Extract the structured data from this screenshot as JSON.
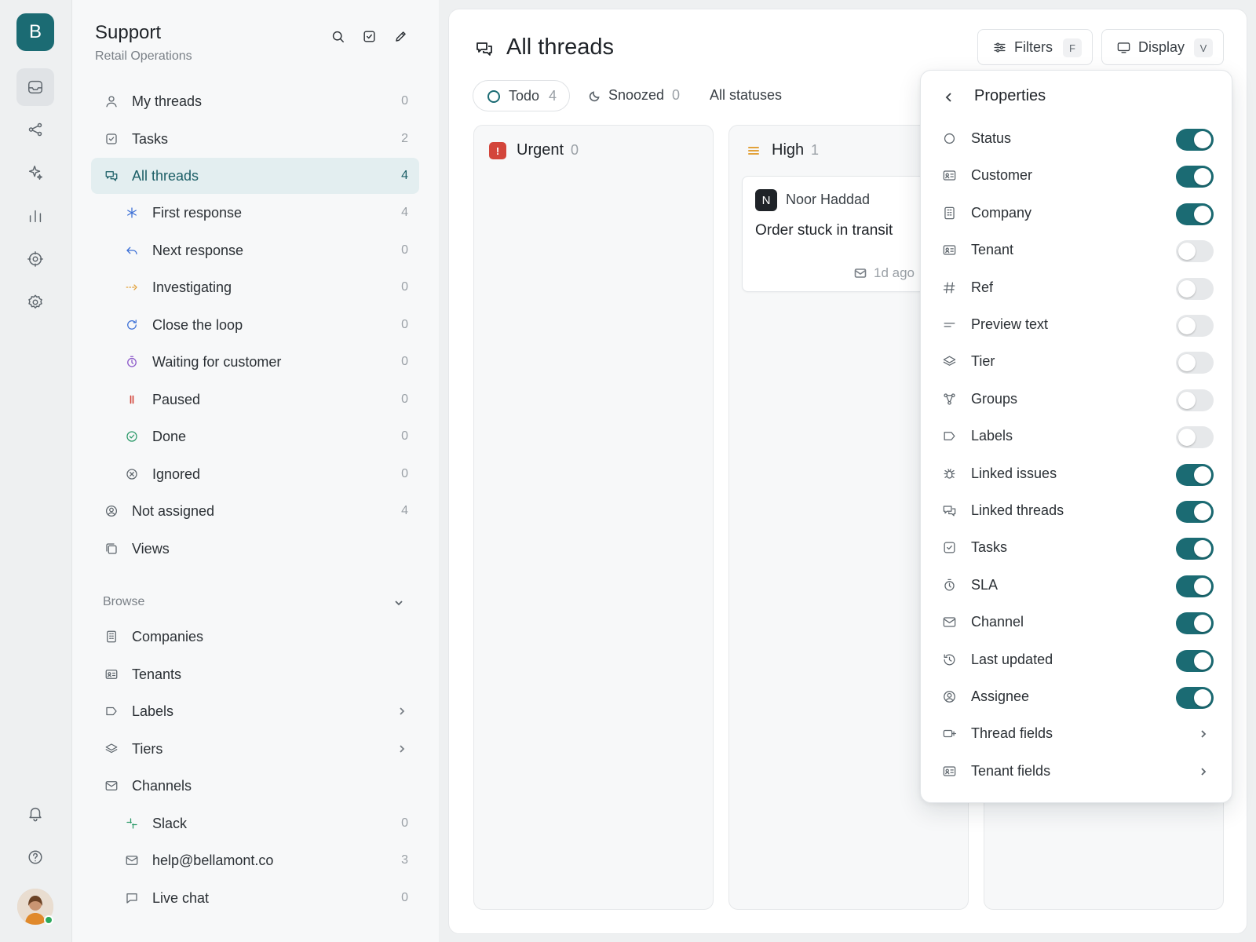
{
  "rail": {
    "workspace_letter": "B",
    "items": [
      "inbox-icon",
      "share-icon",
      "sparkle-icon",
      "chart-icon",
      "target-icon",
      "gear-icon"
    ],
    "bottom": [
      "bell-icon",
      "help-icon"
    ]
  },
  "sidebar": {
    "title": "Support",
    "subtitle": "Retail Operations",
    "nav": [
      {
        "label": "My threads",
        "count": "0",
        "icon": "user-icon"
      },
      {
        "label": "Tasks",
        "count": "2",
        "icon": "check-square-icon"
      },
      {
        "label": "All threads",
        "count": "4",
        "icon": "chat-icon",
        "active": true
      },
      {
        "label": "First response",
        "count": "4",
        "icon": "asterisk-icon",
        "color": "#3b6fd6"
      },
      {
        "label": "Next response",
        "count": "0",
        "icon": "reply-icon",
        "color": "#3b6fd6"
      },
      {
        "label": "Investigating",
        "count": "0",
        "icon": "dashed-arrow-icon",
        "color": "#e2a23b"
      },
      {
        "label": "Close the loop",
        "count": "0",
        "icon": "refresh-icon",
        "color": "#3b6fd6"
      },
      {
        "label": "Waiting for customer",
        "count": "0",
        "icon": "stopwatch-icon",
        "color": "#8a56c9"
      },
      {
        "label": "Paused",
        "count": "0",
        "icon": "pause-icon",
        "color": "#d3453b"
      },
      {
        "label": "Done",
        "count": "0",
        "icon": "check-circle-icon",
        "color": "#2c9a6a"
      },
      {
        "label": "Ignored",
        "count": "0",
        "icon": "x-circle-icon"
      },
      {
        "label": "Not assigned",
        "count": "4",
        "icon": "user-circle-icon"
      },
      {
        "label": "Views",
        "count": "",
        "icon": "views-icon"
      }
    ],
    "browse_label": "Browse",
    "browse": [
      {
        "label": "Companies",
        "icon": "building-icon"
      },
      {
        "label": "Tenants",
        "icon": "id-card-icon"
      },
      {
        "label": "Labels",
        "icon": "tag-icon",
        "chevron": true
      },
      {
        "label": "Tiers",
        "icon": "layers-icon",
        "chevron": true
      },
      {
        "label": "Channels",
        "icon": "mail-icon"
      },
      {
        "label": "Slack",
        "count": "0",
        "icon": "slack-icon",
        "sub": true
      },
      {
        "label": "help@bellamont.co",
        "count": "3",
        "icon": "mail-icon",
        "sub": true
      },
      {
        "label": "Live chat",
        "count": "0",
        "icon": "chat-bubble-icon",
        "sub": true
      }
    ]
  },
  "main": {
    "title": "All threads",
    "filters_label": "Filters",
    "filters_key": "F",
    "display_label": "Display",
    "display_key": "V",
    "tabs": {
      "todo_label": "Todo",
      "todo_count": "4",
      "snoozed_label": "Snoozed",
      "snoozed_count": "0",
      "all_label": "All statuses"
    },
    "columns": [
      {
        "name": "Urgent",
        "count": "0",
        "badge": "!"
      },
      {
        "name": "High",
        "count": "1"
      }
    ],
    "card": {
      "avatar": "N",
      "name": "Noor Haddad",
      "title": "Order stuck in transit",
      "time": "1d ago"
    }
  },
  "properties": {
    "title": "Properties",
    "items": [
      {
        "label": "Status",
        "on": true,
        "icon": "circle-icon"
      },
      {
        "label": "Customer",
        "on": true,
        "icon": "id-card-icon"
      },
      {
        "label": "Company",
        "on": true,
        "icon": "building-icon"
      },
      {
        "label": "Tenant",
        "on": false,
        "icon": "id-card-icon"
      },
      {
        "label": "Ref",
        "on": false,
        "icon": "hash-icon"
      },
      {
        "label": "Preview text",
        "on": false,
        "icon": "text-lines-icon"
      },
      {
        "label": "Tier",
        "on": false,
        "icon": "layers-icon"
      },
      {
        "label": "Groups",
        "on": false,
        "icon": "groups-icon"
      },
      {
        "label": "Labels",
        "on": false,
        "icon": "tag-icon"
      },
      {
        "label": "Linked issues",
        "on": true,
        "icon": "bug-icon"
      },
      {
        "label": "Linked threads",
        "on": true,
        "icon": "chat-icon"
      },
      {
        "label": "Tasks",
        "on": true,
        "icon": "check-square-icon"
      },
      {
        "label": "SLA",
        "on": true,
        "icon": "stopwatch-icon"
      },
      {
        "label": "Channel",
        "on": true,
        "icon": "mail-icon"
      },
      {
        "label": "Last updated",
        "on": true,
        "icon": "history-icon"
      },
      {
        "label": "Assignee",
        "on": true,
        "icon": "user-circle-icon"
      },
      {
        "label": "Thread fields",
        "chevron": true,
        "icon": "field-icon"
      },
      {
        "label": "Tenant fields",
        "chevron": true,
        "icon": "id-card-icon"
      }
    ]
  }
}
